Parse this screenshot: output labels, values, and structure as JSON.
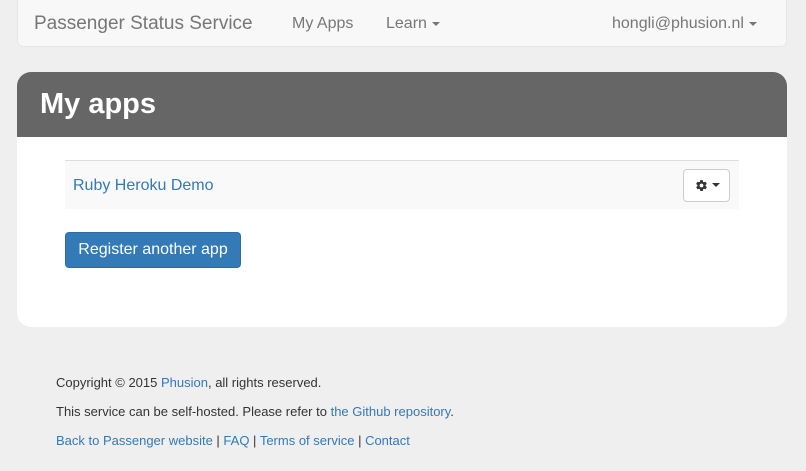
{
  "navbar": {
    "brand": "Passenger Status Service",
    "my_apps": "My Apps",
    "learn": "Learn",
    "user": "hongli@phusion.nl"
  },
  "main": {
    "title": "My apps",
    "apps": [
      {
        "name": "Ruby Heroku Demo"
      }
    ],
    "register_button": "Register another app"
  },
  "footer": {
    "copyright_prefix": "Copyright © 2015 ",
    "company_link": "Phusion",
    "copyright_suffix": ", all rights reserved.",
    "selfhost_prefix": "This service can be self-hosted. Please refer to ",
    "github_link": "the Github repository",
    "selfhost_suffix": ".",
    "links": {
      "passenger": "Back to Passenger website",
      "faq": "FAQ",
      "terms": "Terms of service",
      "contact": "Contact"
    },
    "separator": " | "
  }
}
